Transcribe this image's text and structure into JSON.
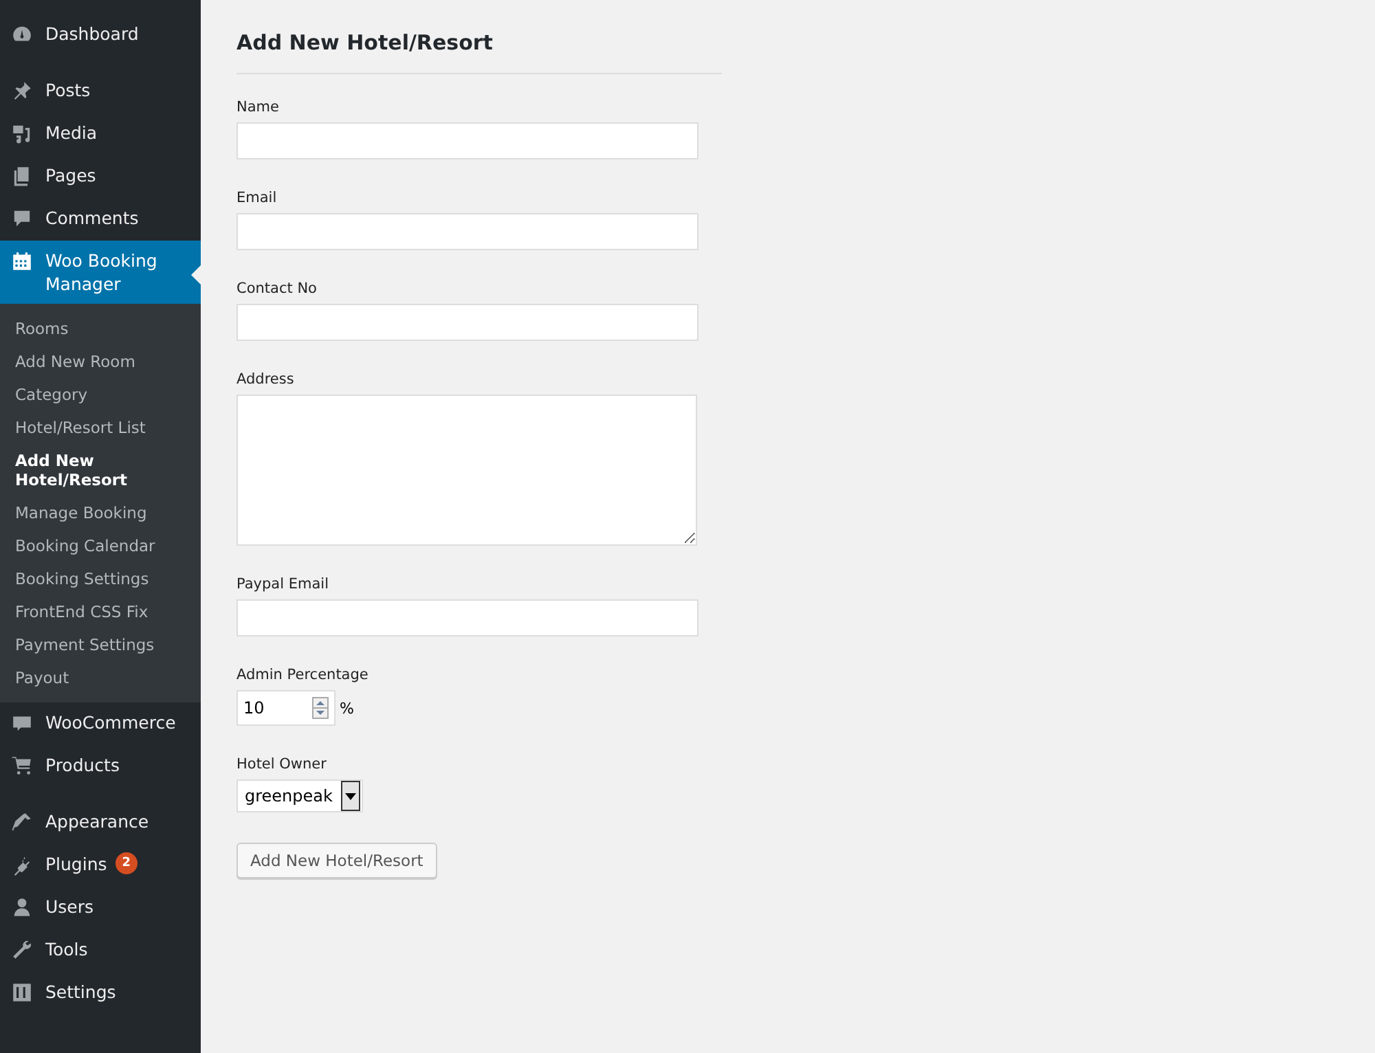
{
  "sidebar": {
    "groups": [
      {
        "items": [
          {
            "label": "Dashboard",
            "selected": false
          }
        ]
      },
      {
        "items": [
          {
            "label": "Posts",
            "selected": false
          },
          {
            "label": "Media",
            "selected": false
          },
          {
            "label": "Pages",
            "selected": false
          },
          {
            "label": "Comments",
            "selected": false
          },
          {
            "label": "Woo Booking Manager",
            "selected": true,
            "submenu": [
              {
                "label": "Rooms",
                "selected": false
              },
              {
                "label": "Add New Room",
                "selected": false
              },
              {
                "label": "Category",
                "selected": false
              },
              {
                "label": "Hotel/Resort List",
                "selected": false
              },
              {
                "label": "Add New Hotel/Resort",
                "selected": true
              },
              {
                "label": "Manage Booking",
                "selected": false
              },
              {
                "label": "Booking Calendar",
                "selected": false
              },
              {
                "label": "Booking Settings",
                "selected": false
              },
              {
                "label": "FrontEnd CSS Fix",
                "selected": false
              },
              {
                "label": "Payment Settings",
                "selected": false
              },
              {
                "label": "Payout",
                "selected": false
              }
            ]
          },
          {
            "label": "WooCommerce",
            "selected": false
          },
          {
            "label": "Products",
            "selected": false
          }
        ]
      },
      {
        "items": [
          {
            "label": "Appearance",
            "selected": false
          },
          {
            "label": "Plugins",
            "selected": false,
            "badge": "2"
          },
          {
            "label": "Users",
            "selected": false
          },
          {
            "label": "Tools",
            "selected": false
          },
          {
            "label": "Settings",
            "selected": false
          }
        ]
      }
    ]
  },
  "form": {
    "title": "Add New Hotel/Resort",
    "fields": [
      {
        "kind": "text",
        "label": "Name"
      },
      {
        "kind": "text",
        "label": "Email"
      },
      {
        "kind": "text",
        "label": "Contact No"
      },
      {
        "kind": "textarea",
        "label": "Address"
      },
      {
        "kind": "text",
        "label": "Paypal Email"
      },
      {
        "kind": "number",
        "label": "Admin Percentage",
        "value": "10",
        "suffix": "%"
      },
      {
        "kind": "select",
        "label": "Hotel Owner",
        "value": "greenpeak"
      }
    ],
    "submit": "Add New Hotel/Resort"
  }
}
